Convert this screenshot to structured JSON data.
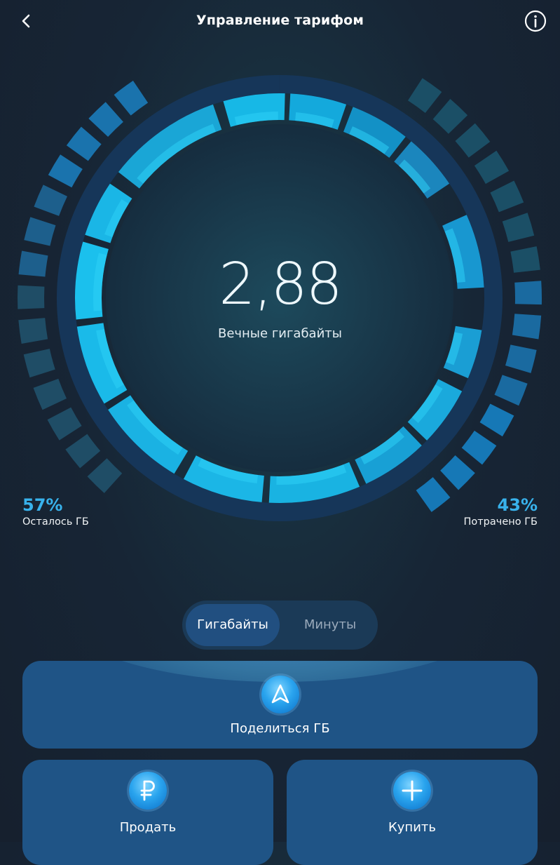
{
  "header": {
    "title": "Управление тарифом"
  },
  "gauge": {
    "value": "2,88",
    "caption": "Вечные гигабайты",
    "remaining_fraction": 0.57,
    "spent_fraction": 0.43
  },
  "stats": {
    "remaining": {
      "percent": "57%",
      "label": "Осталось ГБ"
    },
    "spent": {
      "percent": "43%",
      "label": "Потрачено ГБ"
    }
  },
  "tabs": {
    "gigabytes": "Гигабайты",
    "minutes": "Минуты",
    "active": "gigabytes"
  },
  "actions": {
    "share": {
      "label": "Поделиться ГБ",
      "icon": "share-arrow-icon"
    },
    "sell": {
      "label": "Продать",
      "icon": "ruble-icon"
    },
    "buy": {
      "label": "Купить",
      "icon": "plus-icon"
    }
  },
  "colors": {
    "accent": "#38b2ec",
    "card": "#1f5486",
    "segment_active": "#214f80"
  }
}
